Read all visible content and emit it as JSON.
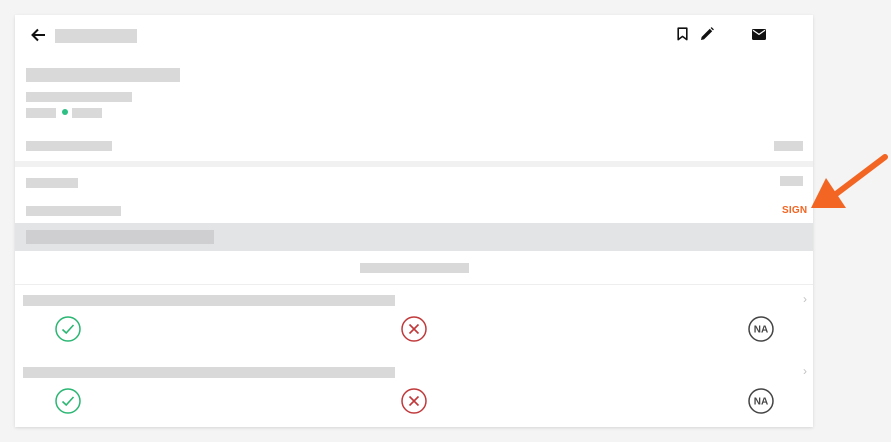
{
  "actions": {
    "sign_label": "SIGN"
  },
  "responses": {
    "na_label": "NA"
  },
  "colors": {
    "accent_orange": "#f26522",
    "pass_green": "#2bb673",
    "fail_red": "#c0393b",
    "status_dot": "#2dbf84",
    "na_grey": "#444444"
  },
  "icons": {
    "back": "arrow-left-icon",
    "bookmark": "bookmark-icon",
    "edit": "pencil-icon",
    "email": "envelope-icon",
    "pass": "check-circle-icon",
    "fail": "x-circle-icon",
    "chevron": "chevron-right-icon"
  }
}
